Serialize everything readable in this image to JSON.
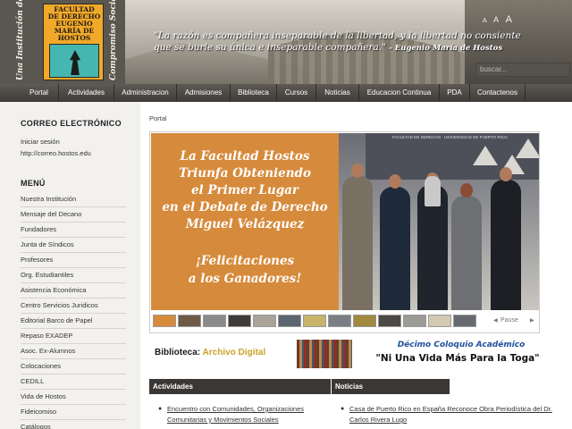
{
  "header": {
    "logo": {
      "left_vertical": "Una Institución de",
      "right_vertical": "Compromiso Social",
      "card_text": "Facultad de Derecho Eugenio María de Hostos"
    },
    "quote": "\"La razón es compañera inseparable de la libertad, y la libertad no consiente que se burle su única e inseparable compañera.\"",
    "quote_author": "- Eugenio María de Hostos",
    "font_sizes": [
      "A",
      "A",
      "A"
    ],
    "search_placeholder": "buscar..."
  },
  "nav": {
    "items": [
      {
        "label": "Portal",
        "active": true
      },
      {
        "label": "Actividades",
        "active": false
      },
      {
        "label": "Administracion",
        "active": false
      },
      {
        "label": "Admisiones",
        "active": false
      },
      {
        "label": "Biblioteca",
        "active": false
      },
      {
        "label": "Cursos",
        "active": false
      },
      {
        "label": "Noticias",
        "active": false
      },
      {
        "label": "Educacion Continua",
        "active": false
      },
      {
        "label": "PDA",
        "active": false
      },
      {
        "label": "Contactenos",
        "active": false
      }
    ],
    "active_color": "#3a6b8f"
  },
  "sidebar": {
    "correo_title": "CORREO ELECTRÓNICO",
    "correo_login": "Iniciar sesión",
    "correo_url": "http://correo.hostos.edu",
    "menu_title": "MENÚ",
    "menu_items": [
      "Nuestra Institución",
      "Mensaje del Decano",
      "Fundadores",
      "Junta de Síndicos",
      "Profesores",
      "Org. Estudiantiles",
      "Asistencia Económica",
      "Centro Servicios Juridicos",
      "Editorial Barco de Papel",
      "Repaso EXADEP",
      "Asoc. Ex-Alumnos",
      "Colocaciones",
      "CEDILL",
      "Vida de Hostos",
      "Fideicomiso",
      "Catálogos"
    ]
  },
  "main": {
    "breadcrumb": "Portal",
    "slide": {
      "headline": [
        "La Facultad Hostos",
        "Triunfa Obteniendo",
        "el Primer Lugar",
        "en el Debate de Derecho",
        "Miguel Velázquez"
      ],
      "congrats": [
        "¡Felicitaciones",
        "a los Ganadores!"
      ],
      "bg_color": "#d68a3b",
      "banner_text": "FACULTAD DE DERECHO · UNIVERSIDAD DE PUERTO RICO"
    },
    "slider_pause": "Pause",
    "promo": {
      "biblioteca_label": "Biblioteca:",
      "archivo_label": "Archivo Digital",
      "coloquio_title": "Décimo Coloquio Académico",
      "coloquio_subtitle": "\"Ni Una Vida Más Para la Toga\""
    },
    "actividades_title": "Actividades",
    "noticias_title": "Noticias",
    "actividades_item": "Encuentro con Comunidades, Organizaciones Comunitarias y Movimientos Sociales",
    "noticias_item": "Casa de Puerto Rico en España Reconoce Obra Periodística del Dr. Carlos Rivera Lugo"
  }
}
